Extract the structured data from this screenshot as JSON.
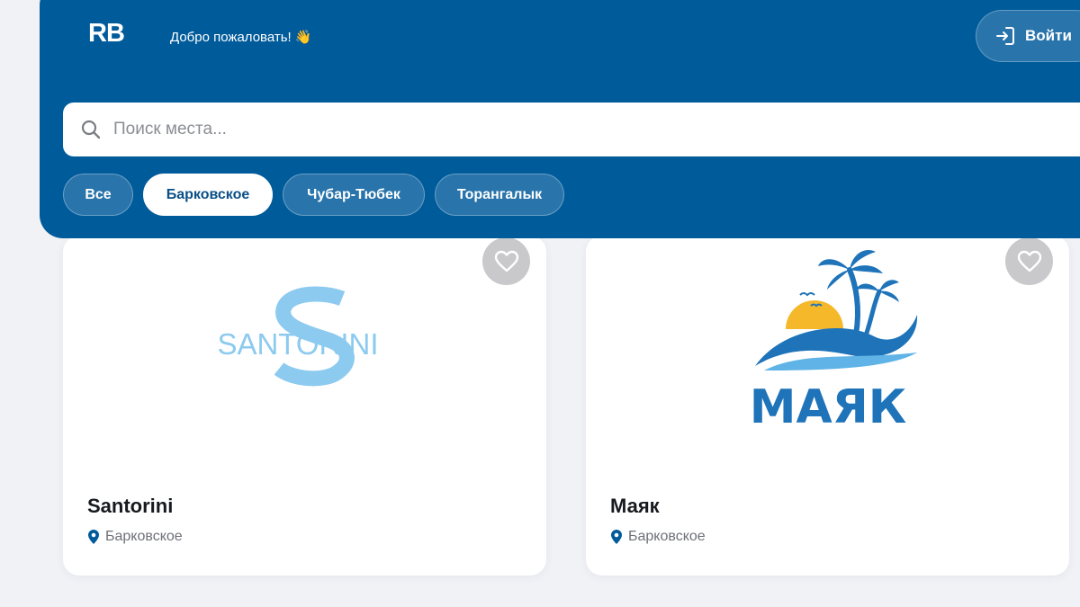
{
  "header": {
    "logo_text": "RB",
    "welcome_text": "Добро пожаловать! 👋",
    "login_label": "Войти",
    "accent_color": "#005b9b"
  },
  "search": {
    "placeholder": "Поиск места..."
  },
  "filters": [
    {
      "label": "Все",
      "active": false
    },
    {
      "label": "Барковское",
      "active": true
    },
    {
      "label": "Чубар-Тюбек",
      "active": false
    },
    {
      "label": "Торангалык",
      "active": false
    }
  ],
  "places": [
    {
      "name": "Santorini",
      "location": "Барковское",
      "logo_text": "SANTORINI",
      "logo_color": "#8ccaf0",
      "favorite": false
    },
    {
      "name": "Маяк",
      "location": "Барковское",
      "logo_text": "МАЯК",
      "logo_color": "#1e73b9",
      "favorite": false
    }
  ]
}
